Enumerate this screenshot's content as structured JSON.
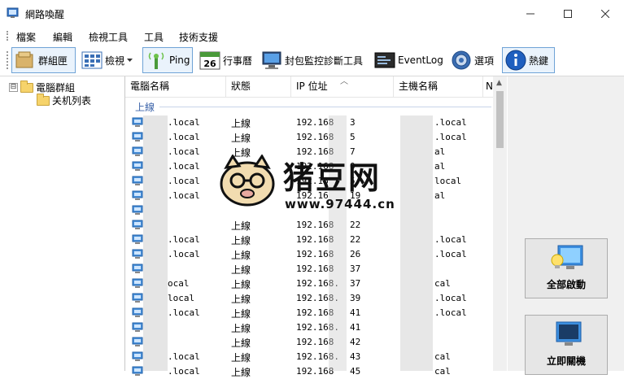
{
  "window": {
    "title": "網路喚醒",
    "controls": [
      "minimize",
      "maximize",
      "close"
    ]
  },
  "menu": [
    "檔案",
    "編輯",
    "檢視工具",
    "工具",
    "技術支援"
  ],
  "toolbar": {
    "group": "群組匣",
    "view": "檢視",
    "ping": "Ping",
    "calendar_day": "26",
    "calendar": "行事曆",
    "packet_tool": "封包監控診斷工具",
    "eventlog": "EventLog",
    "options": "選項",
    "hotkey": "熱鍵"
  },
  "tree": {
    "root": "電腦群組",
    "child": "关机列表",
    "expander": "⊟"
  },
  "list": {
    "columns": [
      "電腦名稱",
      "狀態",
      "IP 位址",
      "主機名稱",
      "N"
    ],
    "group_label": "上線",
    "rows": [
      {
        "name": ".local",
        "status": "上線",
        "ip": "192.168",
        "ip_tail": "3",
        "host": ".local"
      },
      {
        "name": ".local",
        "status": "上線",
        "ip": "192.168",
        "ip_tail": "5",
        "host": ".local"
      },
      {
        "name": ".local",
        "status": "上線",
        "ip": "192.168",
        "ip_tail": "7",
        "host": "al"
      },
      {
        "name": ".local",
        "status": "上線",
        "ip": "192.168",
        "ip_tail": "0",
        "host": "al"
      },
      {
        "name": ".local",
        "status": "上線",
        "ip": "192.16",
        "ip_tail": "5",
        "host": "local"
      },
      {
        "name": ".local",
        "status": "上線",
        "ip": "192.16",
        "ip_tail": "19",
        "host": "al"
      },
      {
        "name": "",
        "status": "",
        "ip": "",
        "ip_tail": "",
        "host": ""
      },
      {
        "name": "",
        "status": "上線",
        "ip": "192.168",
        "ip_tail": "22",
        "host": ""
      },
      {
        "name": ".local",
        "status": "上線",
        "ip": "192.168",
        "ip_tail": "22",
        "host": ".local"
      },
      {
        "name": ".local",
        "status": "上線",
        "ip": "192.168",
        "ip_tail": "26",
        "host": ".local"
      },
      {
        "name": "",
        "status": "上線",
        "ip": "192.168",
        "ip_tail": "37",
        "host": ""
      },
      {
        "name": "ocal",
        "status": "上線",
        "ip": "192.168.",
        "ip_tail": "37",
        "host": "cal"
      },
      {
        "name": "local",
        "status": "上線",
        "ip": "192.168.",
        "ip_tail": "39",
        "host": ".local"
      },
      {
        "name": ".local",
        "status": "上線",
        "ip": "192.168",
        "ip_tail": "41",
        "host": ".local"
      },
      {
        "name": "",
        "status": "上線",
        "ip": "192.168.",
        "ip_tail": "41",
        "host": ""
      },
      {
        "name": "",
        "status": "上線",
        "ip": "192.168",
        "ip_tail": "42",
        "host": ""
      },
      {
        "name": ".local",
        "status": "上線",
        "ip": "192.168.",
        "ip_tail": "43",
        "host": "cal"
      },
      {
        "name": ".local",
        "status": "上線",
        "ip": "192.168",
        "ip_tail": "45",
        "host": "cal"
      }
    ]
  },
  "side_buttons": {
    "wake_all": "全部啟動",
    "shutdown_now": "立即關機"
  },
  "watermark": {
    "text": "猪豆网",
    "url": "www.97444.cn"
  },
  "colors": {
    "group_label": "#3b63a9",
    "toolbar_highlight": "#6fa3d6"
  }
}
